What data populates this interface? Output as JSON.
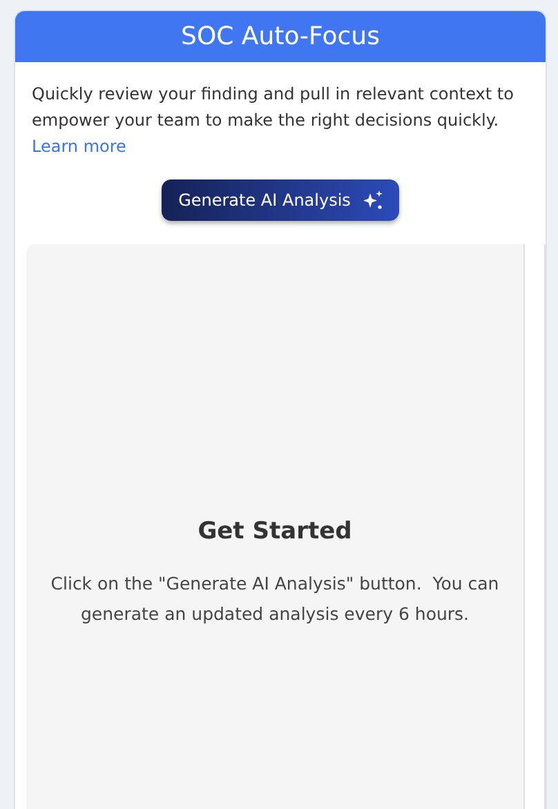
{
  "header": {
    "title": "SOC Auto-Focus"
  },
  "description": {
    "text": "Quickly review your finding and pull in relevant context to empower your team to make the right decisions quickly.",
    "link": "Learn more"
  },
  "action_button": {
    "label": "Generate AI Analysis"
  },
  "panel": {
    "heading": "Get Started",
    "message": "Click on the \"Generate AI Analysis\" button.  You can generate an updated analysis every 6 hours."
  }
}
